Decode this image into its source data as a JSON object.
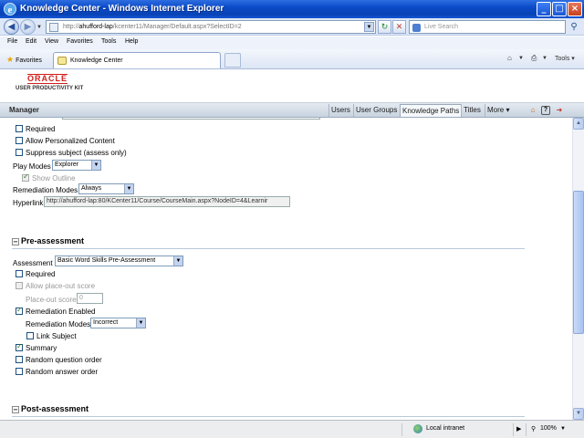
{
  "window": {
    "title": "Knowledge Center - Windows Internet Explorer",
    "buttons": [
      "_",
      "□",
      "×"
    ]
  },
  "address": {
    "url_prefix": "http://",
    "url_host": "ahufford-lap",
    "url_path": "/kcenter11/Manager/Default.aspx?SelectID=2",
    "search_placeholder": "Live Search"
  },
  "menu": [
    "File",
    "Edit",
    "View",
    "Favorites",
    "Tools",
    "Help"
  ],
  "favorites_label": "Favorites",
  "tab": {
    "label": "Knowledge Center"
  },
  "commands": {
    "tools_label": "Tools"
  },
  "logo": {
    "brand": "ORACLE",
    "product": "USER PRODUCTIVITY KIT"
  },
  "manager": {
    "title": "Manager",
    "nav": [
      "Users",
      "User Groups",
      "Knowledge Paths",
      "Titles",
      "More ▾"
    ],
    "active_nav": "Knowledge Paths"
  },
  "form": {
    "required_top": "Required",
    "allow_personalized": "Allow Personalized Content",
    "suppress_subject": "Suppress subject (assess only)",
    "play_modes_label": "Play Modes",
    "play_modes_value": "Explorer",
    "show_outline": "Show Outline",
    "remediation_modes_label": "Remediation Modes",
    "remediation_modes_value": "Always",
    "hyperlink_label": "Hyperlink",
    "hyperlink_value": "http://ahufford-lap:80/KCenter11/Course/CourseMain.aspx?NodeID=4&Learnir",
    "pre_assessment_title": "Pre-assessment",
    "assessment_label": "Assessment",
    "assessment_value": "Basic Word Skills Pre-Assessment",
    "pre_required": "Required",
    "allow_placeout": "Allow place-out score",
    "placeout_label": "Place-out score",
    "placeout_value": "0",
    "remediation_enabled": "Remediation Enabled",
    "pre_remediation_modes_label": "Remediation Modes",
    "pre_remediation_modes_value": "Incorrect",
    "link_subject": "Link Subject",
    "summary": "Summary",
    "random_question": "Random question order",
    "random_answer": "Random answer order",
    "post_assessment_title": "Post-assessment",
    "checked": {
      "required_top": false,
      "allow_personalized": false,
      "suppress_subject": false,
      "show_outline": true,
      "pre_required": false,
      "allow_placeout": false,
      "remediation_enabled": true,
      "link_subject": false,
      "summary": true,
      "random_question": false,
      "random_answer": false
    }
  },
  "status": {
    "zone": "Local intranet",
    "zoom": "100%"
  }
}
